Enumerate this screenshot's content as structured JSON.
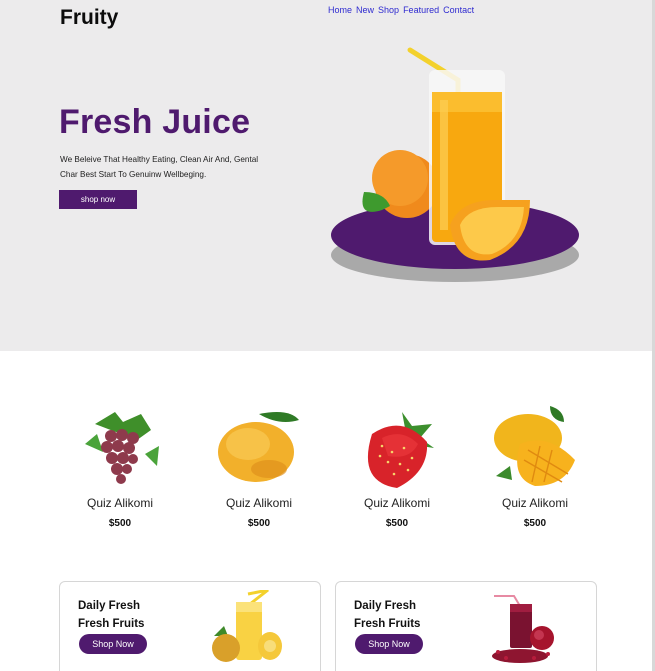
{
  "brand": {
    "logo": "Fruity"
  },
  "nav": {
    "items": [
      "Home",
      "New",
      "Shop",
      "Featured",
      "Contact"
    ]
  },
  "hero": {
    "title": "Fresh Juice",
    "description": "We Beleive That Healthy Eating, Clean Air And, Gental Char Best Start To Genuinw Wellbeging.",
    "button": "shop now"
  },
  "products": [
    {
      "name": "Quiz Alikomi",
      "price": "$500",
      "icon": "grapes-icon"
    },
    {
      "name": "Quiz Alikomi",
      "price": "$500",
      "icon": "mango-icon"
    },
    {
      "name": "Quiz Alikomi",
      "price": "$500",
      "icon": "strawberry-icon"
    },
    {
      "name": "Quiz Alikomi",
      "price": "$500",
      "icon": "cut-mango-icon"
    }
  ],
  "promos": [
    {
      "title_line1": "Daily Fresh",
      "title_line2": "Fresh Fruits",
      "button": "Shop Now",
      "icon": "pineapple-juice-icon"
    },
    {
      "title_line1": "Daily Fresh",
      "title_line2": "Fresh Fruits",
      "button": "Shop Now",
      "icon": "pomegranate-juice-icon"
    }
  ],
  "colors": {
    "accent": "#4f1a6e",
    "hero_bg": "#ecebec",
    "nav_link": "#2f2bd0"
  }
}
